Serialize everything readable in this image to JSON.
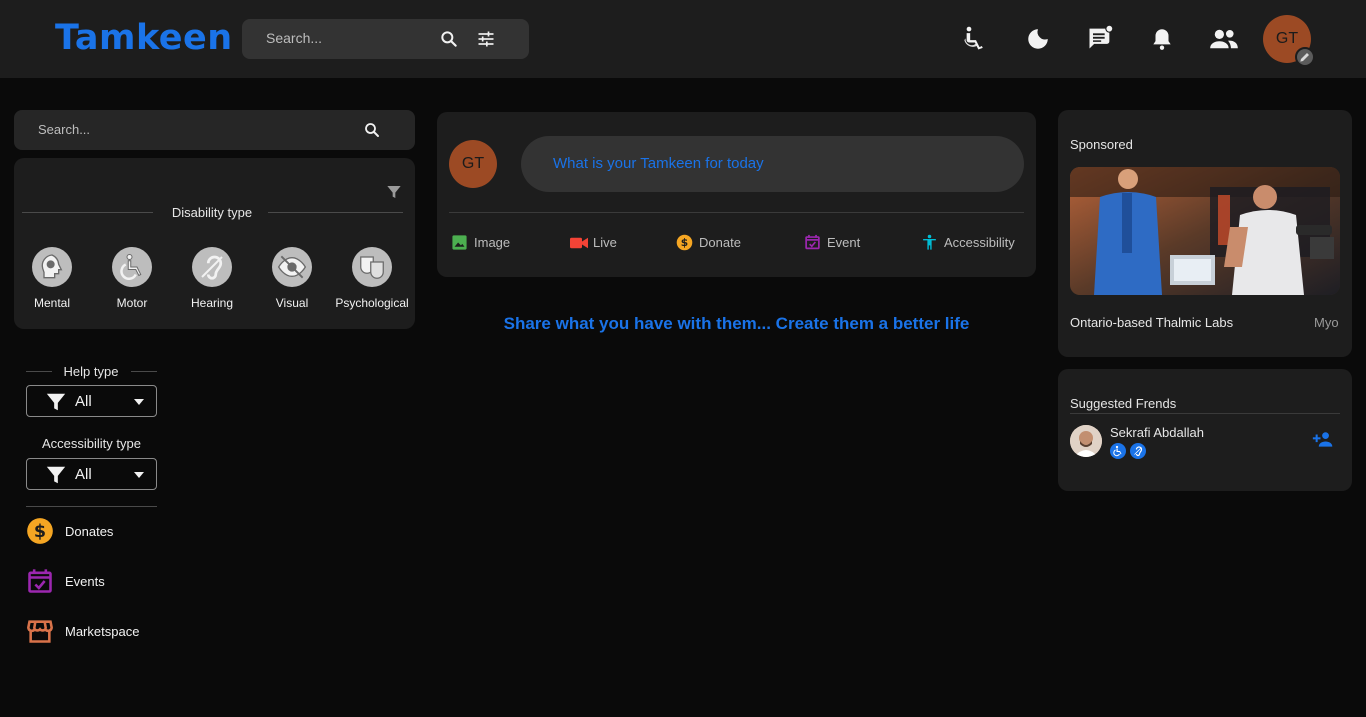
{
  "header": {
    "logo": "Tamkeen",
    "search_placeholder": "Search...",
    "avatar_initials": "GT"
  },
  "sidebar": {
    "search_placeholder": "Search...",
    "disability_title": "Disability type",
    "disabilities": [
      {
        "label": "Mental",
        "icon": "head-brain-icon"
      },
      {
        "label": "Motor",
        "icon": "wheelchair-icon"
      },
      {
        "label": "Hearing",
        "icon": "ear-icon"
      },
      {
        "label": "Visual",
        "icon": "eye-icon"
      },
      {
        "label": "Psychological",
        "icon": "mask-icon"
      }
    ],
    "help_type_title": "Help type",
    "help_type_value": "All",
    "accessibility_type_title": "Accessibility type",
    "accessibility_type_value": "All",
    "nav": [
      {
        "label": "Donates",
        "icon": "dollar-icon",
        "color": "#f5a623"
      },
      {
        "label": "Events",
        "icon": "calendar-check-icon",
        "color": "#9c27b0"
      },
      {
        "label": "Marketspace",
        "icon": "store-icon",
        "color": "#d9734a"
      }
    ]
  },
  "composer": {
    "avatar_initials": "GT",
    "prompt": "What is your Tamkeen for today",
    "actions": [
      {
        "label": "Image",
        "icon": "image-icon",
        "color": "#4caf50"
      },
      {
        "label": "Live",
        "icon": "video-icon",
        "color": "#f44336"
      },
      {
        "label": "Donate",
        "icon": "dollar-icon",
        "color": "#f5a623"
      },
      {
        "label": "Event",
        "icon": "calendar-check-icon",
        "color": "#9c27b0"
      },
      {
        "label": "Accessibility",
        "icon": "accessibility-icon",
        "color": "#00bcd4"
      }
    ]
  },
  "tagline": "Share what you have with them... Create them a better life",
  "sponsored": {
    "title": "Sponsored",
    "caption": "Ontario-based Thalmic Labs",
    "caption_right": "Myo"
  },
  "friends": {
    "title": "Suggested Frends",
    "items": [
      {
        "name": "Sekrafi Abdallah"
      }
    ]
  },
  "colors": {
    "accent": "#1a73e8",
    "avatar": "#9c4a24",
    "surface": "#1d1d1d",
    "background": "#0a0a0a"
  }
}
